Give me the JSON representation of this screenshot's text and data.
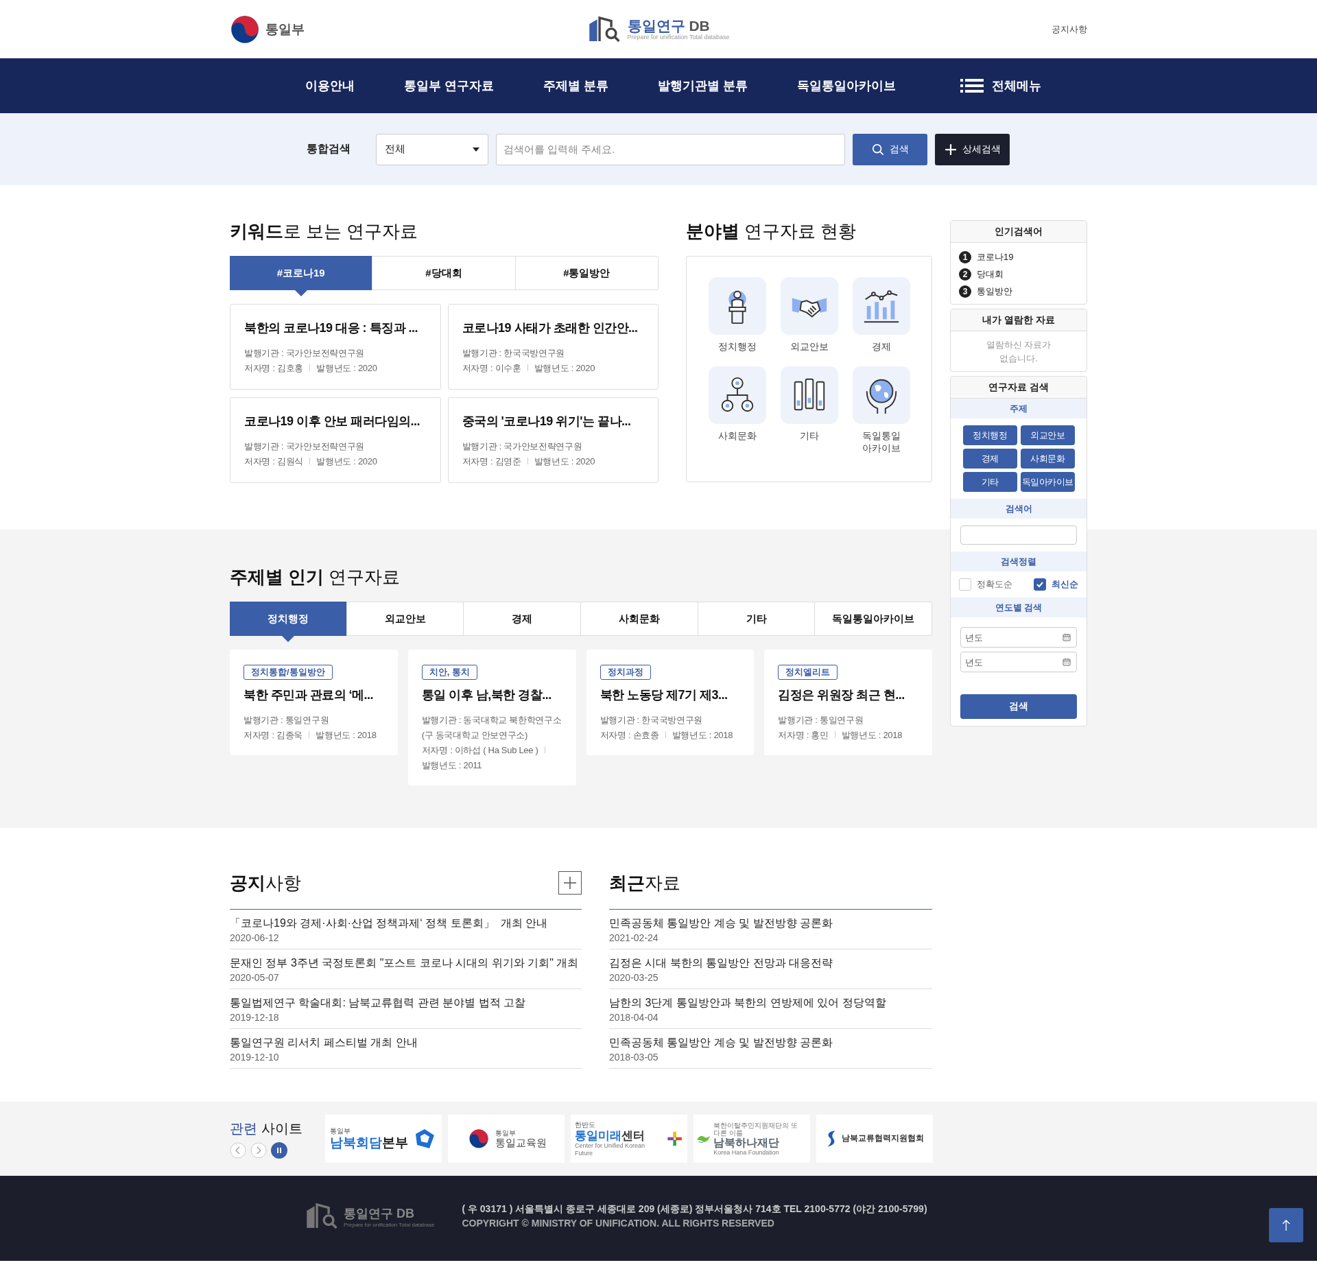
{
  "header": {
    "ministry": "통일부",
    "logo_title": "통일연구",
    "logo_suffix": "DB",
    "logo_subtitle": "Prepare for unification Total database",
    "link": "공지사항"
  },
  "nav": {
    "items": [
      "이용안내",
      "통일부 연구자료",
      "주제별 분류",
      "발행기관별 분류",
      "독일통일아카이브"
    ],
    "all_menu": "전체메뉴"
  },
  "search": {
    "label": "통합검색",
    "scope": "전체",
    "placeholder": "검색어를 입력해 주세요.",
    "search_button": "검색",
    "advanced_button": "상세검색"
  },
  "keyword_section": {
    "title": "**키워드**로 보는 연구자료",
    "tabs": [
      {
        "label": "#코로나19",
        "selected": true
      },
      {
        "label": "#당대회",
        "selected": false
      },
      {
        "label": "#통일방안",
        "selected": false
      }
    ],
    "cards": [
      {
        "title": "북한의 코로나19 대응 : 특징과 ...",
        "publisher": "발행기관 : 국가안보전략연구원",
        "author": "저자명 : 김호홍",
        "year": "발행년도 : 2020"
      },
      {
        "title": "코로나19 사태가 초래한 인간안...",
        "publisher": "발행기관 : 한국국방연구원",
        "author": "저자명 : 이수훈",
        "year": "발행년도 : 2020"
      },
      {
        "title": "코로나19 이후 안보 패러다임의...",
        "publisher": "발행기관 : 국가안보전략연구원",
        "author": "저자명 : 김원식",
        "year": "발행년도 : 2020"
      },
      {
        "title": "중국의 '코로나19 위기'는 끝나...",
        "publisher": "발행기관 : 국가안보전략연구원",
        "author": "저자명 : 김영준",
        "year": "발행년도 : 2020"
      }
    ]
  },
  "field_section": {
    "title": "**분야별** 연구자료 현황",
    "fields": [
      {
        "label": "정치행정",
        "kind": "podium"
      },
      {
        "label": "외교안보",
        "kind": "handshake"
      },
      {
        "label": "경제",
        "kind": "chart"
      },
      {
        "label": "사회문화",
        "kind": "people"
      },
      {
        "label": "기타",
        "kind": "binders"
      },
      {
        "label": "독일통일 아카이브",
        "kind": "globe"
      }
    ]
  },
  "popular_section": {
    "title": "**주제별 인기** 연구자료",
    "tabs": [
      {
        "label": "정치행정",
        "selected": true
      },
      {
        "label": "외교안보",
        "selected": false
      },
      {
        "label": "경제",
        "selected": false
      },
      {
        "label": "사회문화",
        "selected": false
      },
      {
        "label": "기타",
        "selected": false
      },
      {
        "label": "독일통일아카이브",
        "selected": false
      }
    ],
    "cards": [
      {
        "tag": "정치통합/통일방안",
        "title": "북한 주민과 관료의 ‘메...",
        "publisher": "발행기관 : 통일연구원",
        "author": "저자명 : 김종욱",
        "year": "발행년도 : 2018"
      },
      {
        "tag": "치안, 통치",
        "title": "통일 이후 남,북한 경찰...",
        "publisher": "발행기관 : 동국대학교 북한학연구소(구 동국대학교 안보연구소)",
        "author": "저자명 : 이하섭 ( Ha Sub Lee )",
        "year": "발행년도 : 2011"
      },
      {
        "tag": "정치과정",
        "title": "북한 노동당 제7기 제3...",
        "publisher": "발행기관 : 한국국방연구원",
        "author": "저자명 : 손효종",
        "year": "발행년도 : 2018"
      },
      {
        "tag": "정치엘리트",
        "title": "김정은 위원장 최근 현...",
        "publisher": "발행기관 : 통일연구원",
        "author": "저자명 : 홍민",
        "year": "발행년도 : 2018"
      }
    ]
  },
  "sidebar": {
    "popular": {
      "title": "인기검색어",
      "items": [
        {
          "rank": "1",
          "text": "코로나19"
        },
        {
          "rank": "2",
          "text": "당대회"
        },
        {
          "rank": "3",
          "text": "통일방안"
        }
      ]
    },
    "viewed": {
      "title": "내가 열람한 자료",
      "empty": "열람하신 자료가 없습니다."
    },
    "search": {
      "title": "연구자료 검색",
      "topic_label": "주제",
      "topics": [
        "정치행정",
        "외교안보",
        "경제",
        "사회문화",
        "기타",
        "독일아카이브"
      ],
      "keyword_label": "검색어",
      "sort_label": "검색정렬",
      "sorts": [
        {
          "label": "정확도순",
          "checked": false
        },
        {
          "label": "최신순",
          "checked": true
        }
      ],
      "year_label": "연도별 검색",
      "year_fields": [
        {
          "placeholder": "년도"
        },
        {
          "placeholder": "년도"
        }
      ],
      "button": "검색"
    }
  },
  "notices": {
    "title": "**공지**사항",
    "items": [
      {
        "title": "「코로나19와 경제·사회·산업 정책과제‘ 정책 토론회」  개최 안내",
        "date": "2020-06-12"
      },
      {
        "title": "문재인 정부 3주년 국정토론회 \"포스트 코로나 시대의 위기와 기회\" 개최",
        "date": "2020-05-07"
      },
      {
        "title": "통일법제연구 학술대회: 남북교류협력 관련 분야별 법적 고찰",
        "date": "2019-12-18"
      },
      {
        "title": "통일연구원 리서치 페스티벌 개최 안내",
        "date": "2019-12-10"
      }
    ]
  },
  "recent": {
    "title": "**최근**자료",
    "items": [
      {
        "title": "민족공동체 통일방안 계승 및 발전방향 공론화",
        "date": "2021-02-24"
      },
      {
        "title": "김정은 시대 북한의 통일방안 전망과 대응전략",
        "date": "2020-03-25"
      },
      {
        "title": "남한의 3단계 통일방안과 북한의 연방제에 있어 정당역할",
        "date": "2018-04-04"
      },
      {
        "title": "민족공동체 통일방안 계승 및 발전방향 공론화",
        "date": "2018-03-05"
      }
    ]
  },
  "related": {
    "title_accent": "관련",
    "title_rest": "사이트",
    "sites": [
      {
        "kind": "talks",
        "small": "통일부",
        "main_accent": "남북회담",
        "main": "본부"
      },
      {
        "kind": "education",
        "small": "통일부",
        "main": "통일교육원"
      },
      {
        "kind": "future",
        "small": "한반도",
        "main_accent": "통일미래",
        "main": "센터",
        "sub": "Center for Unified Korean Future"
      },
      {
        "kind": "hana",
        "small": "북한이탈주민지원재단의 또 다른 이름",
        "main": "남북하나재단",
        "sub": "Korea Hana Foundation"
      },
      {
        "kind": "exchange",
        "main": "남북교류협력지원협회"
      }
    ]
  },
  "footer": {
    "logo_title": "통일연구",
    "logo_suffix": "DB",
    "logo_subtitle": "Prepare for unification Total database",
    "address": "( 우 03171 ) 서울특별시 종로구 세종대로 209 (세종로) 정부서울청사 714호 TEL 2100-5772 (야간 2100-5799)",
    "copyright": "COPYRIGHT © MINISTRY OF UNIFICATION. ALL RIGHTS RESERVED"
  }
}
